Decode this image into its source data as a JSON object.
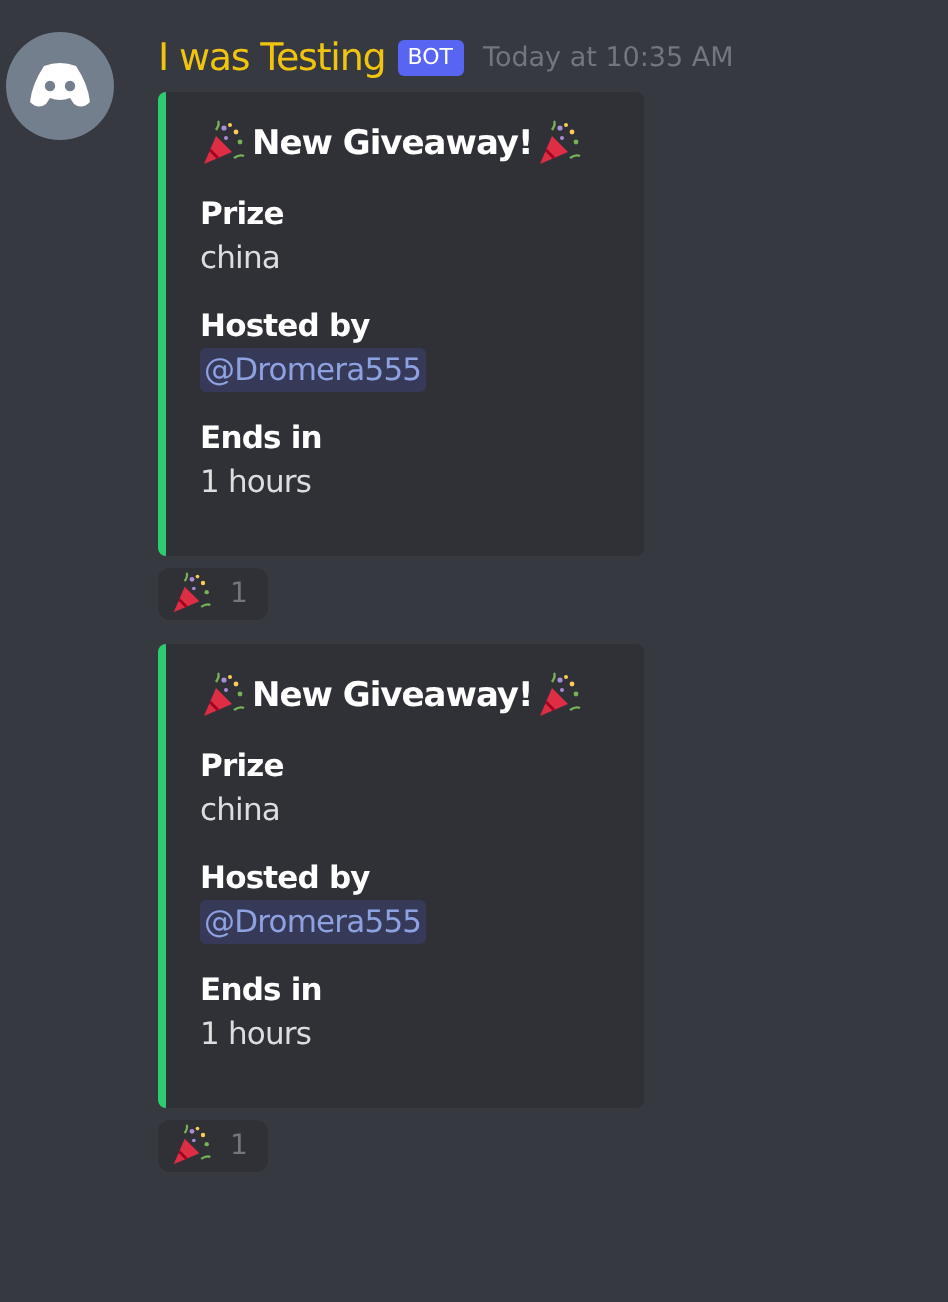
{
  "author": {
    "name": "I was Testing",
    "tag": "BOT",
    "timestamp": "Today at 10:35 AM"
  },
  "messages": [
    {
      "title": "New Giveaway!",
      "fields": [
        {
          "name": "Prize",
          "value": "china",
          "kind": "text"
        },
        {
          "name": "Hosted by",
          "value": "@Dromera555",
          "kind": "mention"
        },
        {
          "name": "Ends in",
          "value": "1 hours",
          "kind": "text"
        }
      ],
      "reaction": {
        "count": "1"
      }
    },
    {
      "title": "New Giveaway!",
      "fields": [
        {
          "name": "Prize",
          "value": "china",
          "kind": "text"
        },
        {
          "name": "Hosted by",
          "value": "@Dromera555",
          "kind": "mention"
        },
        {
          "name": "Ends in",
          "value": "1 hours",
          "kind": "text"
        }
      ],
      "reaction": {
        "count": "1"
      }
    }
  ]
}
